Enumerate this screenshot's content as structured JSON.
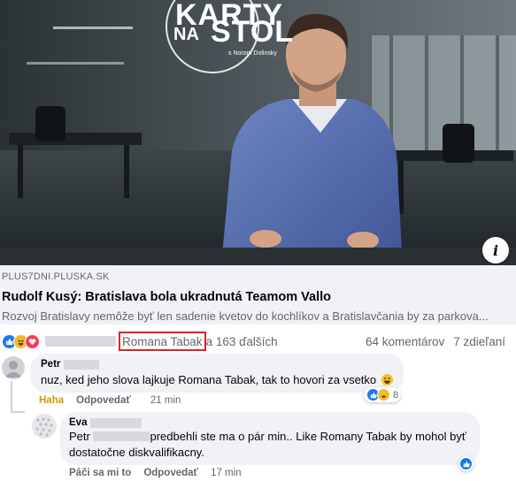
{
  "link_preview": {
    "image_brand": {
      "title_top": "KARTY",
      "title_na": "NA",
      "title_bottom": "STOL",
      "subtitle": "s Norom Dolinsky"
    },
    "info_icon": "info-icon",
    "domain": "PLUS7DNI.PLUSKA.SK",
    "title": "Rudolf Kusý: Bratislava bola ukradnutá Teamom Vallo",
    "description": "Rozvoj Bratislavy nemôže byť len sadenie kvetov do kochlíkov a Bratislavčania by za parkova..."
  },
  "reactions": {
    "icons": [
      "like-icon",
      "haha-icon",
      "love-icon"
    ],
    "highlighted_name": "Romana Tabak",
    "others": "a 163 ďalších",
    "comments_count": "64 komentárov",
    "shares_count": "7 zdieľaní"
  },
  "comments": [
    {
      "author": "Petr",
      "text": "nuz, ked jeho slova lajkuje Romana Tabak, tak to hovori za vsetko",
      "emoji": "grinning-emoji",
      "reaction_label": "Haha",
      "reply_label": "Odpovedať",
      "time": "21 min",
      "reactions_count": "8"
    },
    {
      "author": "Eva",
      "mention": "Petr",
      "text_line1": "predbehli ste ma o pár min.. Like Romany Tabak by mohol byť",
      "text_line2": "dostatočne diskvalifikacny.",
      "reaction_label": "Páči sa mi to",
      "reply_label": "Odpovedať",
      "time": "17 min"
    }
  ],
  "colors": {
    "facebook_blue": "#1877f2",
    "highlight_red": "#e02020",
    "secondary_text": "#65676b",
    "bubble_bg": "#f0f2f5"
  }
}
